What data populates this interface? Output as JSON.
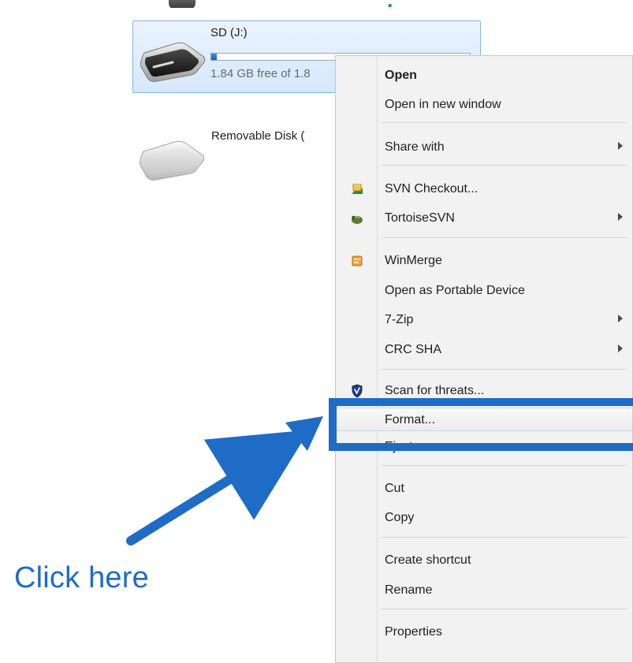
{
  "top_fragment_text": "SD (J:)",
  "drives": [
    {
      "title": "SD (J:)",
      "free_text": "1.84 GB free of 1.8",
      "capacity_fill_fraction": 0.02
    },
    {
      "title": "Removable Disk ("
    }
  ],
  "context_menu": {
    "items": [
      {
        "label": "Open",
        "bold": true
      },
      {
        "label": "Open in new window"
      },
      {
        "label": "Share with"
      },
      {
        "label": "SVN Checkout..."
      },
      {
        "label": "TortoiseSVN"
      },
      {
        "label": "WinMerge"
      },
      {
        "label": "Open as Portable Device"
      },
      {
        "label": "7-Zip"
      },
      {
        "label": "CRC SHA"
      },
      {
        "label": "Scan for threats..."
      },
      {
        "label": "Format..."
      },
      {
        "label": "Eject"
      },
      {
        "label": "Cut"
      },
      {
        "label": "Copy"
      },
      {
        "label": "Create shortcut"
      },
      {
        "label": "Rename"
      },
      {
        "label": "Properties"
      }
    ]
  },
  "callout": {
    "text": "Click here"
  },
  "colors": {
    "accent": "#1e6cc5",
    "green": "#16a34a",
    "menu_bg": "#f2f2f2"
  },
  "icons": {
    "svn_checkout": "svn-checkout-icon",
    "tortoise": "tortoisesvn-icon",
    "winmerge": "winmerge-icon",
    "scan": "shield-scan-icon",
    "drive": "removable-drive-icon"
  }
}
